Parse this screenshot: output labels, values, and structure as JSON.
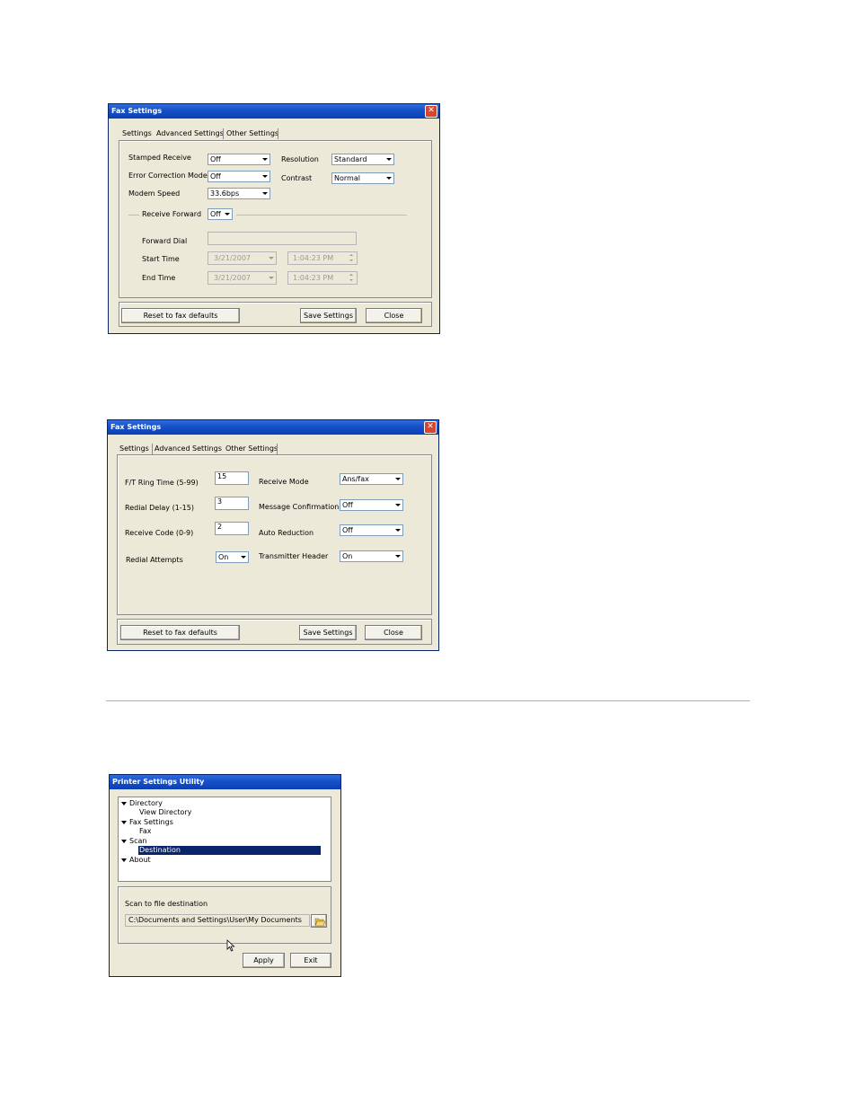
{
  "window1": {
    "title": "Fax Settings",
    "tabs": [
      "Settings",
      "Advanced Settings",
      "Other Settings"
    ],
    "stamped_receive": {
      "label": "Stamped Receive",
      "value": "Off"
    },
    "error_correction": {
      "label": "Error Correction Mode",
      "value": "Off"
    },
    "modem_speed": {
      "label": "Modem Speed",
      "value": "33.6bps"
    },
    "resolution": {
      "label": "Resolution",
      "value": "Standard"
    },
    "contrast": {
      "label": "Contrast",
      "value": "Normal"
    },
    "receive_forward": {
      "label": "Receive Forward",
      "value": "Off"
    },
    "forward_dial": {
      "label": "Forward Dial",
      "value": ""
    },
    "start_time": {
      "label": "Start Time",
      "date": "3/21/2007",
      "time": "1:04:23 PM"
    },
    "end_time": {
      "label": "End Time",
      "date": "3/21/2007",
      "time": "1:04:23 PM"
    },
    "buttons": {
      "reset": "Reset to fax defaults",
      "save": "Save Settings",
      "close": "Close"
    }
  },
  "window2": {
    "title": "Fax Settings",
    "tabs": [
      "Settings",
      "Advanced Settings",
      "Other Settings"
    ],
    "ft_ring_time": {
      "label": "F/T Ring Time (5-99)",
      "value": "15"
    },
    "redial_delay": {
      "label": "Redial Delay (1-15)",
      "value": "3"
    },
    "receive_code": {
      "label": "Receive Code (0-9)",
      "value": "2"
    },
    "redial_attempts": {
      "label": "Redial Attempts",
      "value": "On"
    },
    "receive_mode": {
      "label": "Receive Mode",
      "value": "Ans/fax"
    },
    "message_confirmation": {
      "label": "Message Confirmation",
      "value": "Off"
    },
    "auto_reduction": {
      "label": "Auto Reduction",
      "value": "Off"
    },
    "transmitter_header": {
      "label": "Transmitter Header",
      "value": "On"
    },
    "buttons": {
      "reset": "Reset to fax defaults",
      "save": "Save Settings",
      "close": "Close"
    }
  },
  "window3": {
    "title": "Printer Settings Utility",
    "tree": {
      "directory": "Directory",
      "view_directory": "View Directory",
      "fax_settings": "Fax Settings",
      "fax": "Fax",
      "scan": "Scan",
      "destination": "Destination",
      "about": "About"
    },
    "scan_label": "Scan to file destination",
    "path": "C:\\Documents and Settings\\User\\My Documents",
    "buttons": {
      "apply": "Apply",
      "exit": "Exit"
    }
  }
}
